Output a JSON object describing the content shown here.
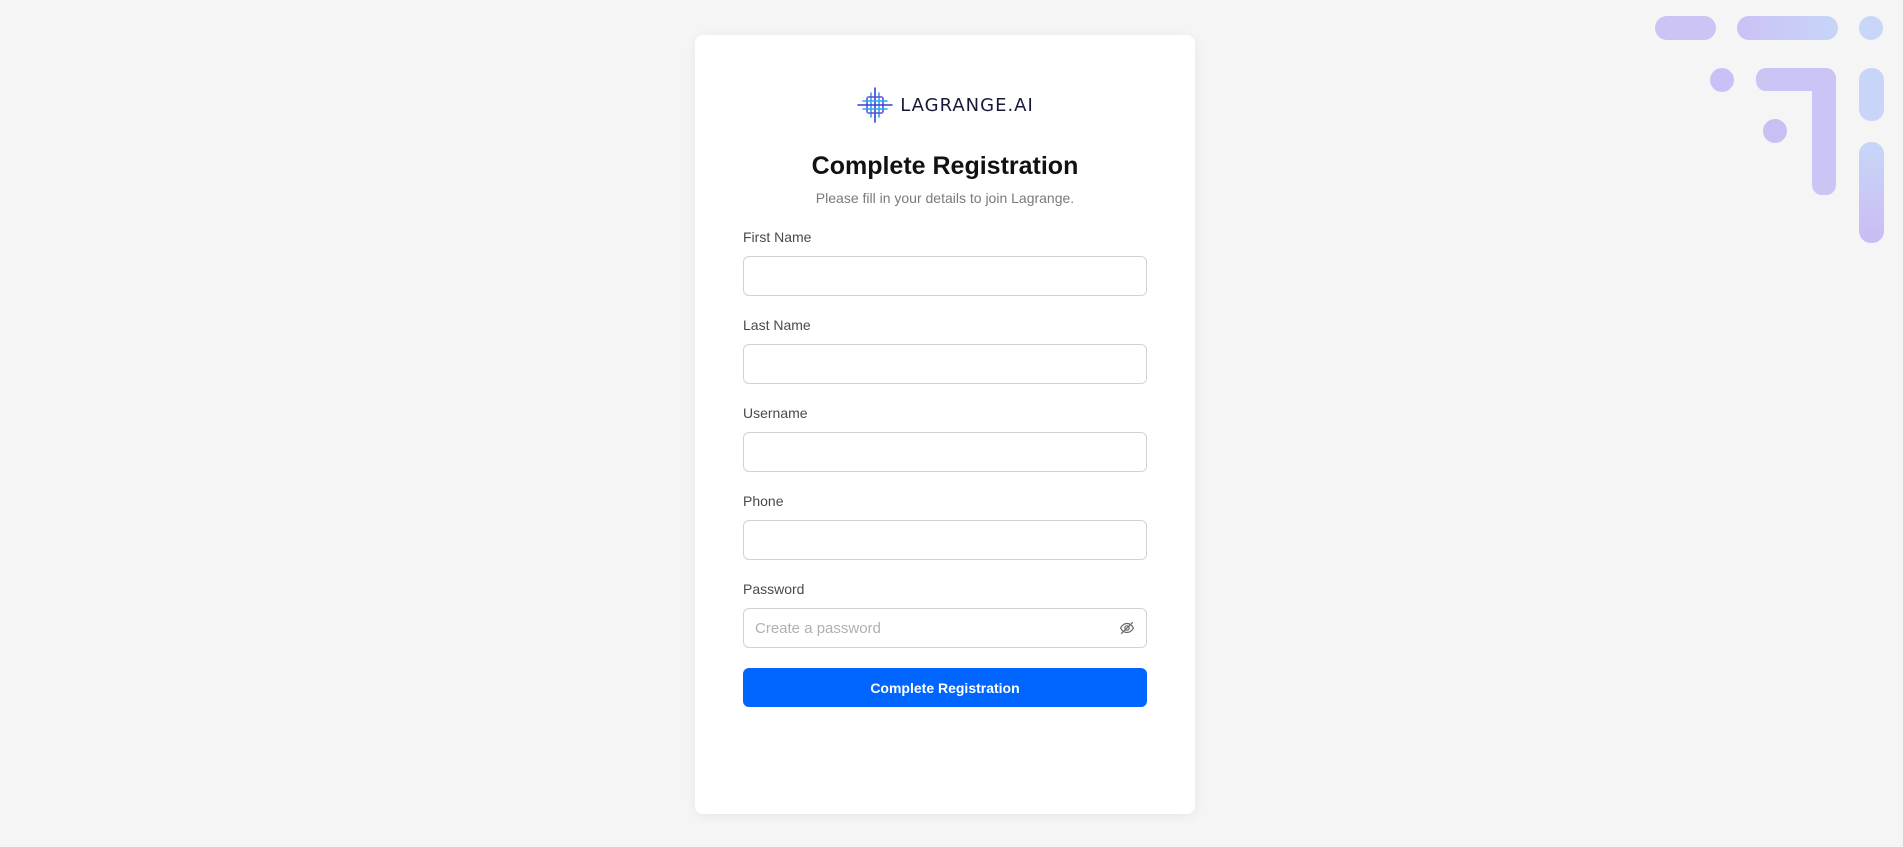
{
  "brand": {
    "logo_text": "LAGRANGE.AI",
    "icon": "lagrange-logo-mark"
  },
  "header": {
    "title": "Complete Registration",
    "subtitle": "Please fill in your details to join Lagrange."
  },
  "form": {
    "fields": [
      {
        "label": "First Name",
        "value": "",
        "placeholder": ""
      },
      {
        "label": "Last Name",
        "value": "",
        "placeholder": ""
      },
      {
        "label": "Username",
        "value": "",
        "placeholder": ""
      },
      {
        "label": "Phone",
        "value": "",
        "placeholder": ""
      },
      {
        "label": "Password",
        "value": "",
        "placeholder": "Create a password",
        "icon": "eye-off-icon"
      }
    ],
    "submit_label": "Complete Registration"
  },
  "colors": {
    "accent": "#0066ff",
    "background": "#f5f5f5",
    "card": "#ffffff",
    "decoration_purple": "#c9c3f5",
    "decoration_blue": "#c5d5f7"
  }
}
